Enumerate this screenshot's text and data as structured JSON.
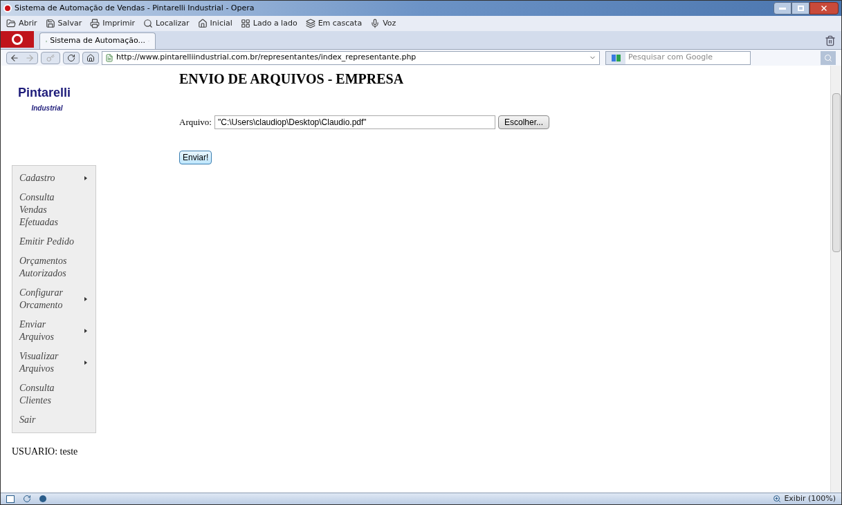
{
  "window": {
    "title": "Sistema de Automação de Vendas - Pintarelli Industrial - Opera"
  },
  "toolbar": [
    {
      "label": "Abrir",
      "kind": "open"
    },
    {
      "label": "Salvar",
      "kind": "save"
    },
    {
      "label": "Imprimir",
      "kind": "print"
    },
    {
      "label": "Localizar",
      "kind": "find"
    },
    {
      "label": "Inicial",
      "kind": "home"
    },
    {
      "label": "Lado a lado",
      "kind": "tile"
    },
    {
      "label": "Em cascata",
      "kind": "cascade"
    },
    {
      "label": "Voz",
      "kind": "voice"
    }
  ],
  "tabs": [
    {
      "label": "Sistema de Automação...",
      "selected": true
    }
  ],
  "address_bar": {
    "url": "http://www.pintarelliindustrial.com.br/representantes/index_representante.php"
  },
  "search": {
    "placeholder": "Pesquisar com Google"
  },
  "logo": {
    "name": "Pintarelli",
    "subtitle": "Industrial"
  },
  "menu": [
    {
      "lines": [
        "Cadastro"
      ],
      "has_submenu": true
    },
    {
      "lines": [
        "Consulta",
        "Vendas",
        "Efetuadas"
      ],
      "has_submenu": false
    },
    {
      "lines": [
        "Emitir Pedido"
      ],
      "has_submenu": false
    },
    {
      "lines": [
        "Orçamentos",
        "Autorizados"
      ],
      "has_submenu": false
    },
    {
      "lines": [
        "Configurar",
        "Orcamento"
      ],
      "has_submenu": true
    },
    {
      "lines": [
        "Enviar",
        "Arquivos"
      ],
      "has_submenu": true
    },
    {
      "lines": [
        "Visualizar",
        "Arquivos"
      ],
      "has_submenu": true
    },
    {
      "lines": [
        "Consulta",
        "Clientes"
      ],
      "has_submenu": false
    },
    {
      "lines": [
        "Sair"
      ],
      "has_submenu": false
    }
  ],
  "user": "USUARIO: teste",
  "form": {
    "heading": "ENVIO DE ARQUIVOS - EMPRESA",
    "file_label": "Arquivo:",
    "file_value": "\"C:\\Users\\claudiop\\Desktop\\Claudio.pdf\"",
    "browse_button": "Escolher...",
    "submit_button": "Enviar!"
  },
  "status_bar": {
    "zoom": "Exibir (100%)"
  }
}
